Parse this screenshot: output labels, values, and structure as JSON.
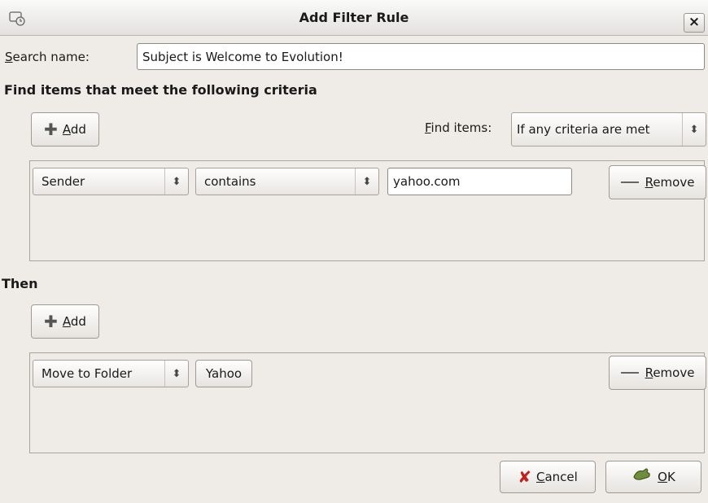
{
  "window": {
    "title": "Add Filter Rule",
    "close_symbol": "×"
  },
  "search": {
    "label_mnemonic": "S",
    "label_rest": "earch name:",
    "value": "Subject is Welcome to Evolution!"
  },
  "criteria": {
    "heading": "Find items that meet the following criteria",
    "add_mnemonic": "A",
    "add_rest": "dd",
    "find_label_mnemonic": "F",
    "find_label_rest": "ind items:",
    "find_mode": "If any criteria are met",
    "rows": [
      {
        "field": "Sender",
        "operator": "contains",
        "value": "yahoo.com",
        "remove_mnemonic": "R",
        "remove_rest": "emove"
      }
    ]
  },
  "then": {
    "heading": "Then",
    "add_mnemonic": "A",
    "add_rest": "dd",
    "rows": [
      {
        "action": "Move to Folder",
        "folder": "Yahoo",
        "remove_mnemonic": "R",
        "remove_rest": "emove"
      }
    ]
  },
  "footer": {
    "cancel_mnemonic": "C",
    "cancel_rest": "ancel",
    "ok_mnemonic": "O",
    "ok_rest": "K"
  },
  "icons": {
    "app": "evolution-filter-icon",
    "add": "plus-icon",
    "remove": "minus-icon",
    "cancel": "cancel-x-icon",
    "ok": "ok-hand-icon",
    "combo": "updown-arrow-icon"
  }
}
